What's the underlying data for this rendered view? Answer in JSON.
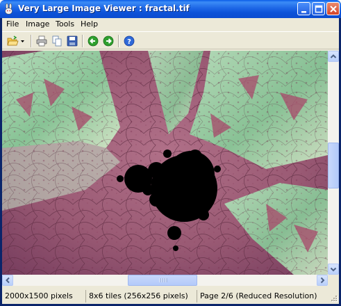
{
  "window": {
    "title": "Very Large Image Viewer : fractal.tif",
    "app_icon": "rabbit-icon"
  },
  "menu": {
    "items": [
      "File",
      "Image",
      "Tools",
      "Help"
    ]
  },
  "toolbar": {
    "buttons": [
      "open-folder-icon",
      "dropdown-arrow-icon",
      "print-icon",
      "copy-icon",
      "save-icon",
      "back-icon",
      "forward-icon",
      "help-icon"
    ]
  },
  "status": {
    "dimensions": "2000x1500 pixels",
    "tiles": "8x6 tiles (256x256 pixels)",
    "page": "Page 2/6 (Reduced Resolution)"
  },
  "colors": {
    "title_bar": "#0b4cd0",
    "chrome": "#ece9d8",
    "fractal_pink": "#a0607a",
    "fractal_green": "#8fd4a2",
    "fractal_black": "#000000"
  }
}
